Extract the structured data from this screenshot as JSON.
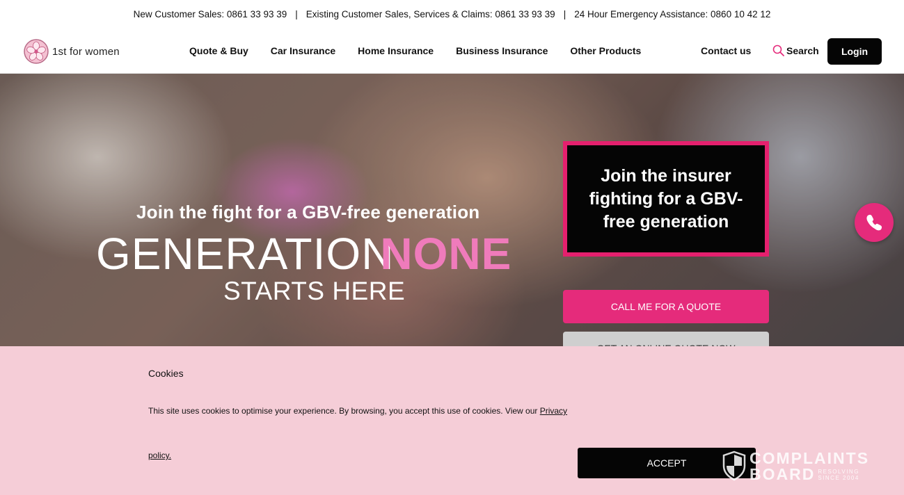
{
  "topbar": {
    "new_sales": "New Customer Sales: 0861 33 93 39",
    "existing": "Existing Customer Sales, Services & Claims: 0861 33 93 39",
    "emergency": "24 Hour Emergency Assistance: 0860 10 42 12",
    "separator": "|"
  },
  "nav": {
    "logo_text": "1st for women",
    "items": [
      {
        "label": "Quote & Buy"
      },
      {
        "label": "Car Insurance"
      },
      {
        "label": "Home Insurance"
      },
      {
        "label": "Business Insurance"
      },
      {
        "label": "Other Products"
      }
    ],
    "contact": "Contact us",
    "search": "Search",
    "login": "Login",
    "accent": "#e52b7b"
  },
  "hero": {
    "subtitle": "Join the fight for a GBV-free generation",
    "big_white": "GENERATION",
    "big_pink": "NONE",
    "starts": "STARTS HERE",
    "promo": "Join the insurer fighting for a GBV-free generation",
    "call_button": "CALL ME FOR A QUOTE",
    "online_button": "GET AN ONLINE QUOTE NOW",
    "pink": "#e52b7b",
    "phone_icon": "phone-icon"
  },
  "cookie": {
    "title": "Cookies",
    "text": "This site uses cookies to optimise your experience. By browsing, you accept this use of cookies. View our ",
    "link_part1": "Privacy",
    "link_part2": "policy.",
    "accept": "ACCEPT",
    "background": "#f5cdd7"
  },
  "complaints_board": {
    "line1": "COMPLAINTS",
    "line2": "BOARD",
    "tag1": "RESOLVING",
    "tag2": "SINCE 2004"
  }
}
